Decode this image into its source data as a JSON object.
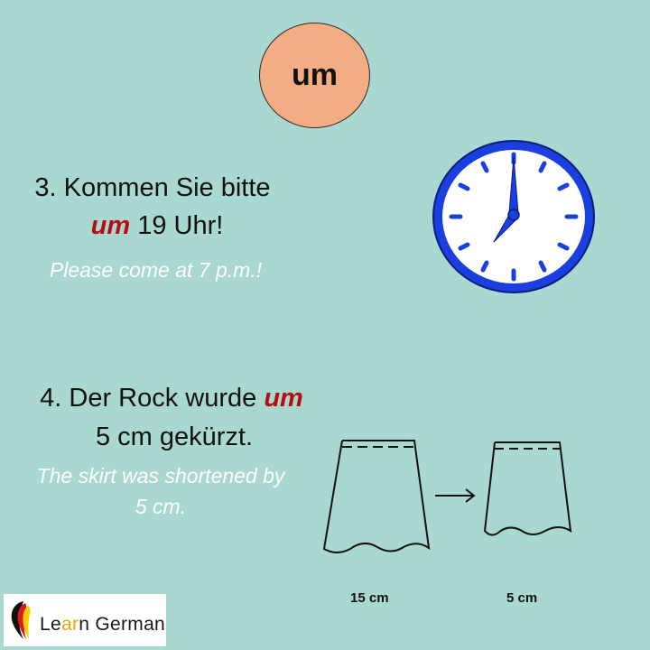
{
  "header": {
    "word": "um"
  },
  "example3": {
    "line1": "3. Kommen Sie bitte",
    "highlight": "um",
    "line2_rest": " 19 Uhr!",
    "translation": "Please come at 7 p.m.!"
  },
  "example4": {
    "line1_start": "4. Der Rock wurde ",
    "highlight": "um",
    "line2": "5 cm gekürzt.",
    "translation_line1": "The skirt was shortened by",
    "translation_line2": "5 cm."
  },
  "skirt_labels": {
    "before": "15 cm",
    "after": "5 cm"
  },
  "logo": {
    "part1": "Le",
    "part2": "ar",
    "part3": "n German"
  },
  "colors": {
    "background": "#a8d8cf",
    "bubble": "#f4ac85",
    "highlight": "#b50d12",
    "clock": "#1a3fe0"
  },
  "icons": [
    "clock-icon",
    "long-skirt-icon",
    "arrow-right-icon",
    "short-skirt-icon",
    "germany-flag-icon"
  ]
}
